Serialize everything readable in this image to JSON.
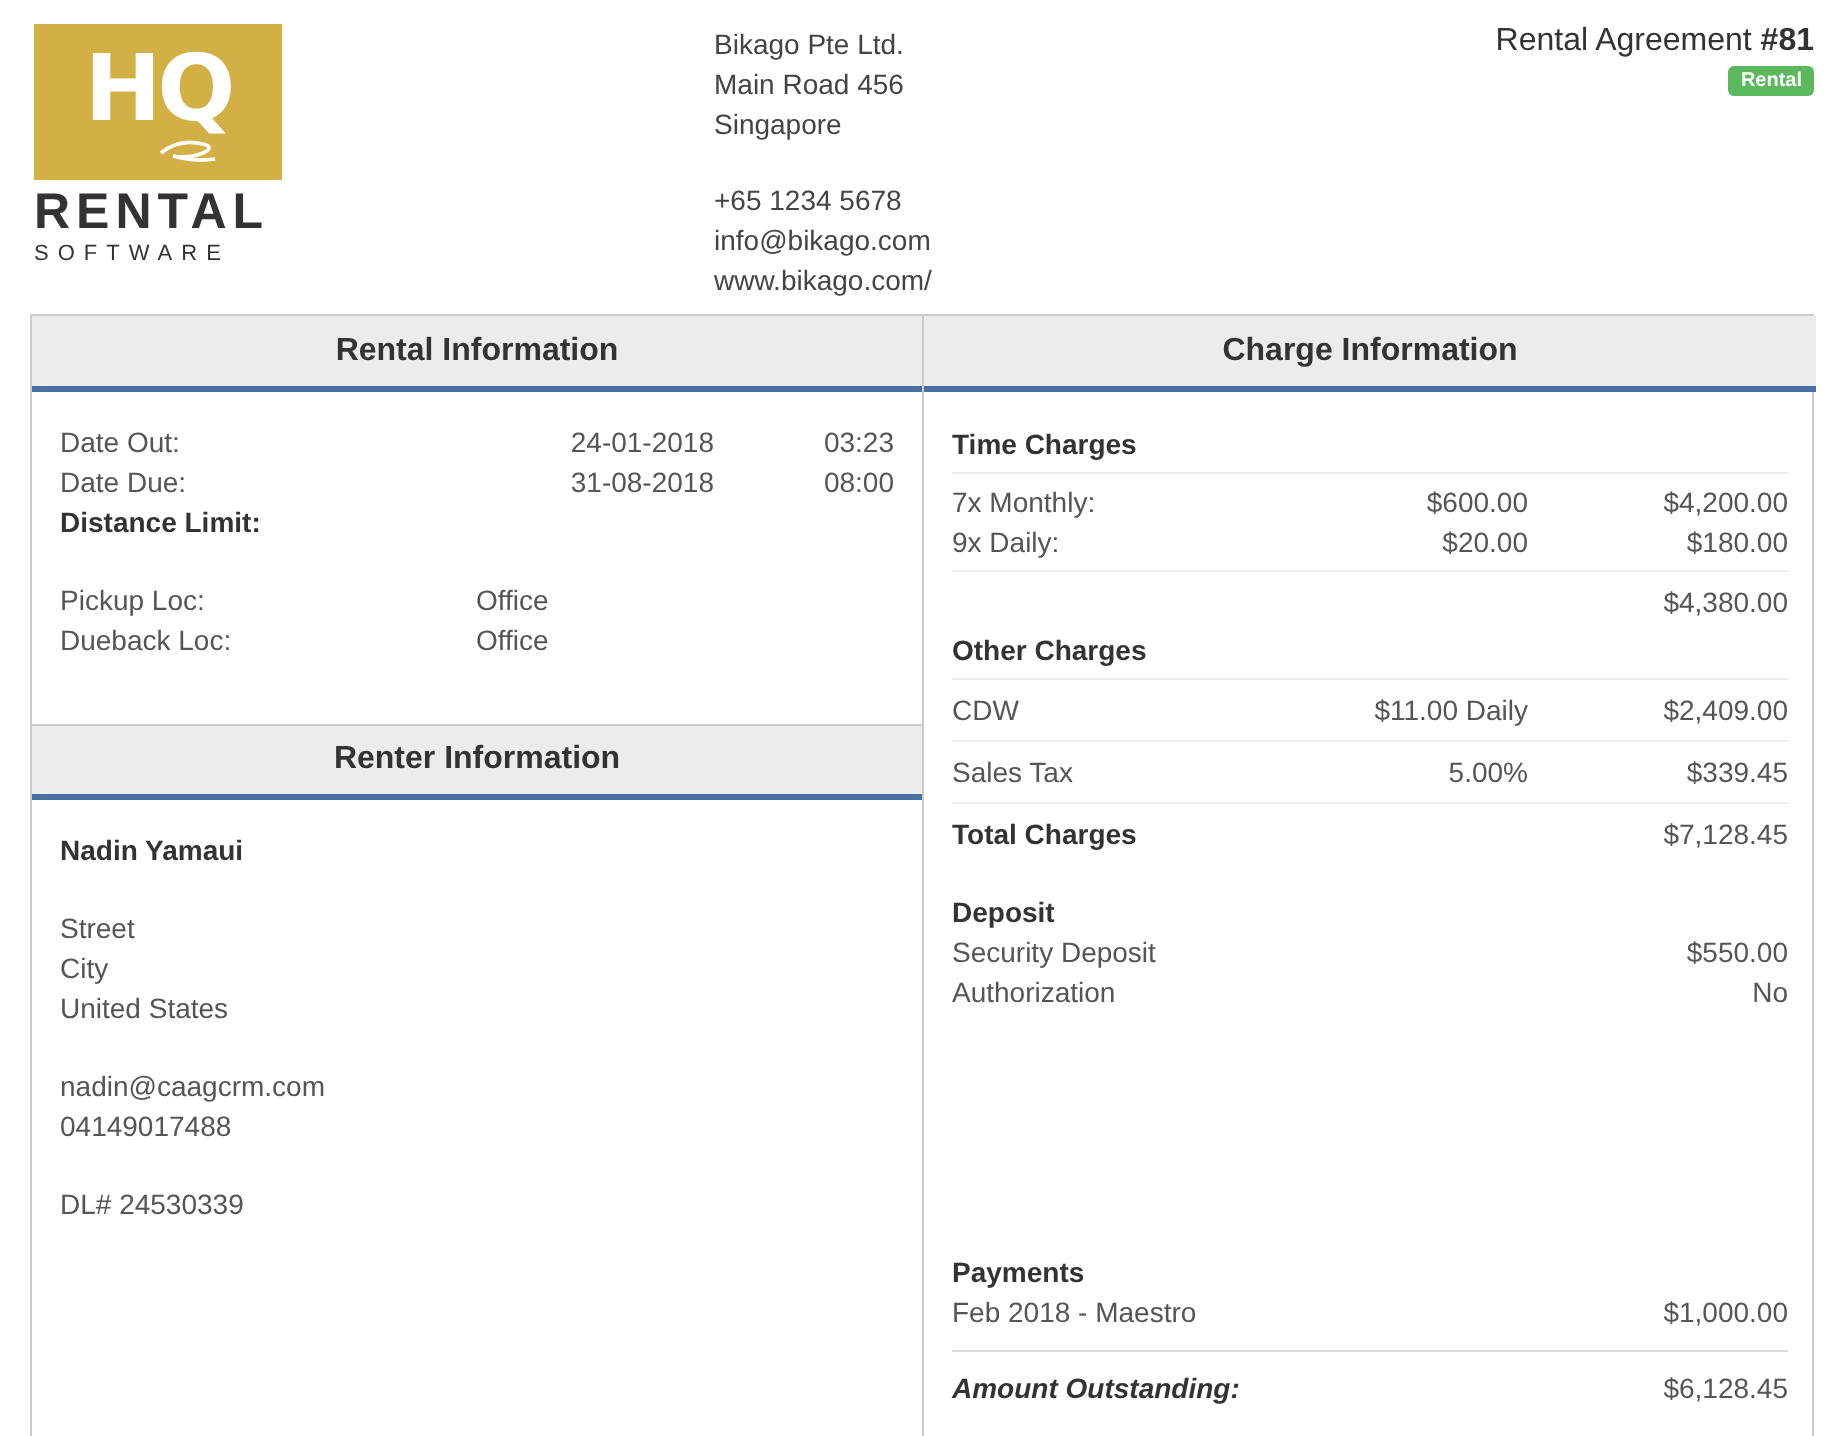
{
  "logo": {
    "mark": "HQ",
    "word": "RENTAL",
    "subword": "SOFTWARE"
  },
  "company": {
    "address": [
      "Bikago Pte Ltd.",
      "Main Road 456",
      "Singapore"
    ],
    "contact": [
      "+65 1234 5678",
      "info@bikago.com",
      "www.bikago.com/"
    ]
  },
  "agreement": {
    "title": "Rental Agreement ",
    "number": "#81",
    "badge": "Rental"
  },
  "rental_information": {
    "title": "Rental Information",
    "dates": [
      {
        "label": "Date Out:",
        "date": "24-01-2018",
        "time": "03:23"
      },
      {
        "label": "Date Due:",
        "date": "31-08-2018",
        "time": "08:00"
      }
    ],
    "distance_limit": "Distance Limit:",
    "locations": [
      {
        "label": "Pickup Loc:",
        "value": "Office"
      },
      {
        "label": "Dueback Loc:",
        "value": "Office"
      }
    ]
  },
  "renter_information": {
    "title": "Renter Information",
    "name": "Nadin Yamaui",
    "address": [
      "Street",
      "City",
      "United States"
    ],
    "contact": [
      "nadin@caagcrm.com",
      "04149017488"
    ],
    "license": "DL# 24530339"
  },
  "charge_information": {
    "title": "Charge Information",
    "time_charges": {
      "title": "Time Charges",
      "rows": [
        {
          "label": "7x Monthly:",
          "rate": "$600.00",
          "amount": "$4,200.00"
        },
        {
          "label": "9x Daily:",
          "rate": "$20.00",
          "amount": "$180.00"
        }
      ],
      "subtotal": "$4,380.00"
    },
    "other_charges": {
      "title": "Other Charges",
      "rows": [
        {
          "label": "CDW",
          "rate": "$11.00 Daily",
          "amount": "$2,409.00"
        },
        {
          "label": "Sales Tax",
          "rate": "5.00%",
          "amount": "$339.45"
        }
      ]
    },
    "total": {
      "label": "Total Charges",
      "amount": "$7,128.45"
    },
    "deposit": {
      "title": "Deposit",
      "rows": [
        {
          "label": "Security Deposit",
          "value": "$550.00"
        },
        {
          "label": "Authorization",
          "value": "No"
        }
      ]
    },
    "payments": {
      "title": "Payments",
      "rows": [
        {
          "label": "Feb 2018 - Maestro",
          "amount": "$1,000.00"
        }
      ]
    },
    "outstanding": {
      "label": "Amount Outstanding:",
      "amount": "$6,128.45"
    }
  }
}
